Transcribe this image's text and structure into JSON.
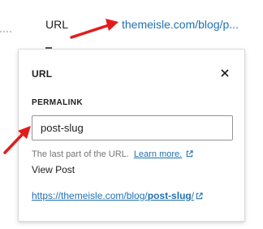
{
  "sidebar_field": {
    "label": "URL",
    "link_text": "themeisle.com/blog/p..."
  },
  "popover": {
    "title": "URL",
    "close_icon": "close-icon",
    "section_label": "PERMALINK",
    "slug_value": "post-slug",
    "help_text": "The last part of the URL.",
    "learn_more": "Learn more.",
    "view_post_label": "View Post",
    "link_prefix": "https://themeisle.com/blog/",
    "link_slug": "post-slug",
    "link_suffix": "/"
  },
  "colors": {
    "link": "#2271b1",
    "arrow": "#e31b1b",
    "border": "#dcdcde"
  }
}
